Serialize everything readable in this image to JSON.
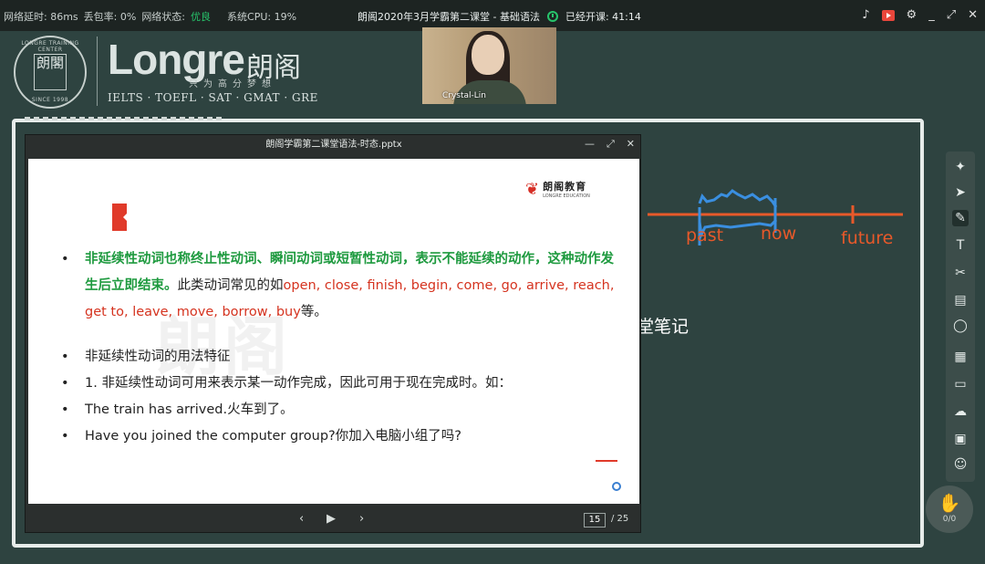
{
  "topbar": {
    "latency": "网络延时: 86ms",
    "packet_loss": "丢包率: 0%",
    "network_state_label": "网络状态:",
    "network_state_value": "优良",
    "cpu": "系统CPU: 19%",
    "class_title": "朗阁2020年3月学霸第二课堂 - 基础语法",
    "elapsed_label": "已经开课: 41:14"
  },
  "brand": {
    "seal_ring_top": "LONGRE TRAINING CENTER",
    "seal_chars": "朗閣",
    "seal_ring_bottom": "SINCE 1998",
    "wordmark": "Longre",
    "wordmark_cn": "朗阁",
    "slogan": "只为高分梦想",
    "tests": "IELTS · TOEFL · SAT · GMAT · GRE"
  },
  "webcam": {
    "name": "Crystal-Lin"
  },
  "board": {
    "timeline_labels": [
      "past",
      "now",
      "future"
    ],
    "notes_text": "堂笔记",
    "accent_color": "#e8592a",
    "scribble_color": "#3a8fe0"
  },
  "ppt": {
    "title": "朗阁学霸第二课堂语法-时态.pptx",
    "logo_cn": "朗阁教育",
    "logo_en": "LONGRE EDUCATION",
    "watermark": "朗阁",
    "bullet1_green": "非延续性动词也称终止性动词、瞬间动词或短暂性动词，表示不能延续的动作，这种动作发生后立即结束。",
    "bullet1_black": "此类动词常见的如",
    "bullet1_red": "open, close, finish, begin, come, go, arrive, reach, get to, leave, move, borrow, buy",
    "bullet1_end": "等。",
    "bullet2": "非延续性动词的用法特征",
    "bullet3": "1. 非延续性动词可用来表示某一动作完成，因此可用于现在完成时。如：",
    "bullet4": "The train has arrived.火车到了。",
    "bullet5": "Have you joined the computer group?你加入电脑小组了吗?",
    "current_page": "15",
    "total_pages": "/ 25"
  },
  "hand": {
    "count": "0/0"
  }
}
